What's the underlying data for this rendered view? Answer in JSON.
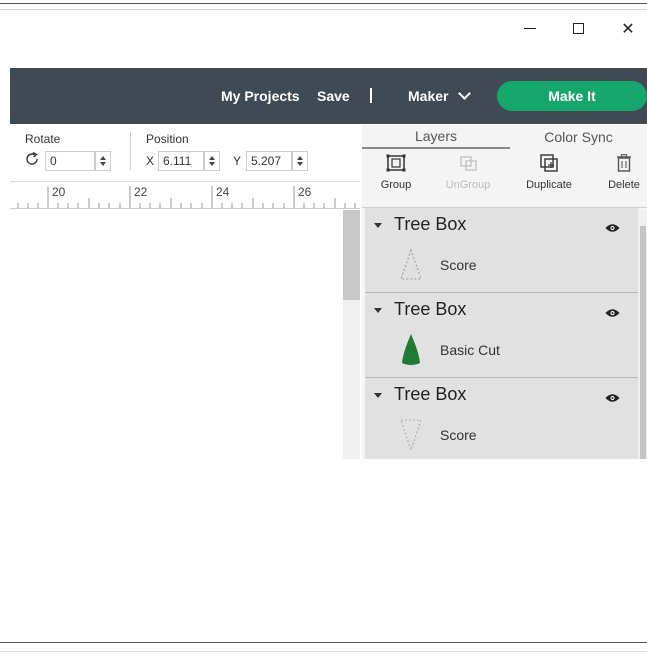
{
  "window": {
    "controls": {
      "minimize": "minimize",
      "maximize": "maximize",
      "close": "✕"
    }
  },
  "header": {
    "my_projects": "My Projects",
    "save": "Save",
    "maker": "Maker",
    "make_it": "Make It",
    "colors": {
      "bar": "#3f4a55",
      "make_it": "#14a66b"
    }
  },
  "options": {
    "rotate": {
      "label": "Rotate",
      "value": "0"
    },
    "position": {
      "label": "Position",
      "x_label": "X",
      "x_value": "6.111",
      "y_label": "Y",
      "y_value": "5.207"
    }
  },
  "ruler": {
    "ticks": [
      "20",
      "22",
      "24",
      "26"
    ]
  },
  "panel": {
    "tabs": [
      "Layers",
      "Color Sync"
    ],
    "tools": [
      {
        "label": "Group",
        "icon": "group-icon",
        "enabled": true
      },
      {
        "label": "UnGroup",
        "icon": "ungroup-icon",
        "enabled": false
      },
      {
        "label": "Duplicate",
        "icon": "duplicate-icon",
        "enabled": true
      },
      {
        "label": "Delete",
        "icon": "trash-icon",
        "enabled": true
      }
    ],
    "groups": [
      {
        "title": "Tree Box",
        "layer": {
          "label": "Score",
          "thumbnail": "dashed-triangle-score"
        }
      },
      {
        "title": "Tree Box",
        "layer": {
          "label": "Basic Cut",
          "thumbnail": "green-cone",
          "color": "#1f7a32"
        }
      },
      {
        "title": "Tree Box",
        "layer": {
          "label": "Score",
          "thumbnail": "dashed-inverted-triangle-score"
        }
      }
    ]
  }
}
